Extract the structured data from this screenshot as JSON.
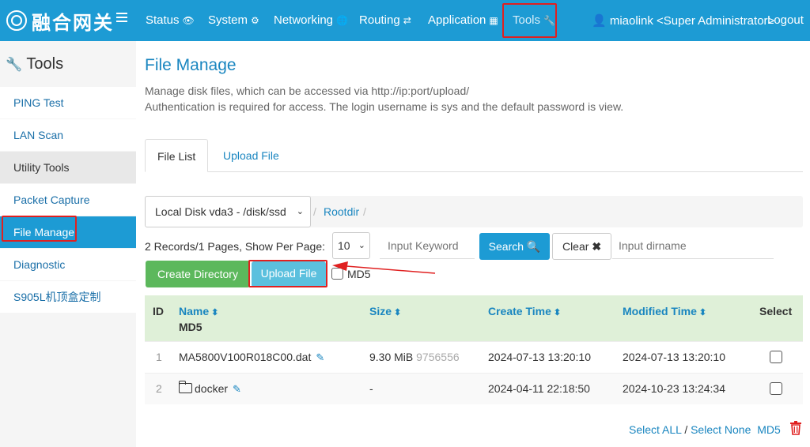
{
  "header": {
    "brand": "融合网关",
    "nav": [
      {
        "label": "Status",
        "icon": "eye-icon"
      },
      {
        "label": "System",
        "icon": "gear-icon"
      },
      {
        "label": "Networking",
        "icon": "globe-icon"
      },
      {
        "label": "Routing",
        "icon": "shuffle-icon"
      },
      {
        "label": "Application",
        "icon": "grid-icon"
      },
      {
        "label": "Tools",
        "icon": "wrench-icon"
      }
    ],
    "user": "miaolink <Super Administrator>",
    "logout": "Logout"
  },
  "sidebar": {
    "title": "Tools",
    "items": [
      {
        "label": "PING Test"
      },
      {
        "label": "LAN Scan"
      },
      {
        "label": "Utility Tools"
      },
      {
        "label": "Packet Capture"
      },
      {
        "label": "File Manage"
      },
      {
        "label": "Diagnostic"
      },
      {
        "label": "S905L机顶盒定制"
      }
    ]
  },
  "main": {
    "title": "File Manage",
    "desc1": "Manage disk files, which can be accessed via http://ip:port/upload/",
    "desc2": "Authentication is required for access. The login username is sys and the default password is view.",
    "tabs": [
      "File List",
      "Upload File"
    ],
    "disk": "Local Disk vda3 - /disk/ssd",
    "breadcrumb_root": "Rootdir",
    "records": "2 Records/1 Pages, Show Per Page:",
    "per_page": "10",
    "keyword_placeholder": "Input Keyword",
    "search_label": "Search",
    "clear_label": "Clear",
    "dirname_placeholder": "Input dirname",
    "create_dir_label": "Create Directory",
    "upload_label": "Upload File",
    "md5_label": "MD5",
    "columns": {
      "id": "ID",
      "name": "Name",
      "md5": "MD5",
      "size": "Size",
      "create": "Create Time",
      "modified": "Modified Time",
      "select": "Select"
    },
    "rows": [
      {
        "id": "1",
        "name": "MA5800V100R018C00.dat",
        "size": "9.30 MiB",
        "size_bytes": "9756556",
        "create": "2024-07-13 13:20:10",
        "modified": "2024-07-13 13:20:10"
      },
      {
        "id": "2",
        "name": "docker",
        "size": "-",
        "size_bytes": "",
        "create": "2024-04-11 22:18:50",
        "modified": "2024-10-23 13:24:34"
      }
    ],
    "footer": {
      "select_all": "Select ALL",
      "slash": "/",
      "select_none": "Select None",
      "md5": "MD5"
    }
  },
  "colors": {
    "primary": "#1d9bd4",
    "highlight": "#e02020",
    "success": "#5cb85c",
    "info": "#5bc0de",
    "table_header": "#dff0d8"
  }
}
